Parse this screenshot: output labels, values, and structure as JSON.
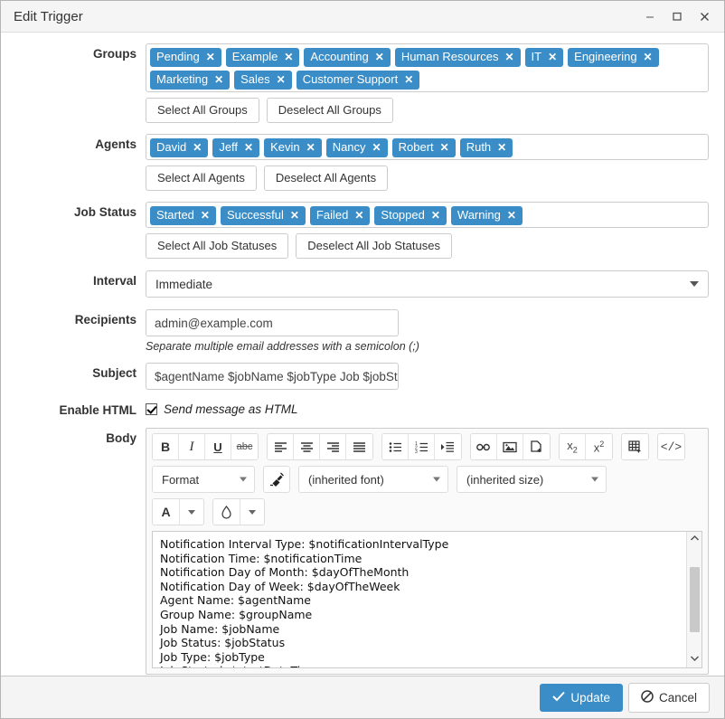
{
  "window": {
    "title": "Edit Trigger",
    "controls": [
      {
        "name": "minimize-button",
        "glyph": "–"
      },
      {
        "name": "maximize-button",
        "glyph": "❑"
      },
      {
        "name": "close-button",
        "glyph": "✕"
      }
    ]
  },
  "accent_color": "#3a8dc6",
  "form": {
    "groups": {
      "label": "Groups",
      "tokens": [
        "Pending",
        "Example",
        "Accounting",
        "Human Resources",
        "IT",
        "Engineering",
        "Marketing",
        "Sales",
        "Customer Support"
      ],
      "select_all": "Select All Groups",
      "deselect_all": "Deselect All Groups"
    },
    "agents": {
      "label": "Agents",
      "tokens": [
        "David",
        "Jeff",
        "Kevin",
        "Nancy",
        "Robert",
        "Ruth"
      ],
      "select_all": "Select All Agents",
      "deselect_all": "Deselect All Agents"
    },
    "job_status": {
      "label": "Job Status",
      "tokens": [
        "Started",
        "Successful",
        "Failed",
        "Stopped",
        "Warning"
      ],
      "select_all": "Select All Job Statuses",
      "deselect_all": "Deselect All Job Statuses"
    },
    "interval": {
      "label": "Interval",
      "value": "Immediate"
    },
    "recipients": {
      "label": "Recipients",
      "value": "admin@example.com",
      "hint": "Separate multiple email addresses with a semicolon (;)"
    },
    "subject": {
      "label": "Subject",
      "value": "$agentName $jobName $jobType Job $jobStatus"
    },
    "enable_html": {
      "label": "Enable HTML",
      "checkbox_label": "Send message as HTML",
      "checked": true
    },
    "body": {
      "label": "Body",
      "toolbar": {
        "format_select": "Format",
        "font_select": "(inherited font)",
        "size_select": "(inherited size)",
        "buttons": [
          "bold",
          "italic",
          "underline",
          "strikethrough",
          "align-left",
          "align-center",
          "align-right",
          "align-justify",
          "bullet-list",
          "numbered-list",
          "indent",
          "link",
          "image",
          "insert-page",
          "subscript",
          "superscript",
          "table",
          "source-code",
          "remove-format",
          "text-color",
          "highlight-color"
        ],
        "text_color_glyph": "A"
      },
      "content": "Notification Interval Type: $notificationIntervalType\nNotification Time: $notificationTime\nNotification Day of Month: $dayOfTheMonth\nNotification Day of Week: $dayOfTheWeek\nAgent Name: $agentName\nGroup Name: $groupName\nJob Name: $jobName\nJob Status: $jobStatus\nJob Type: $jobType\nJob Started: $startDateTime"
    }
  },
  "footer": {
    "update_label": "Update",
    "cancel_label": "Cancel"
  }
}
